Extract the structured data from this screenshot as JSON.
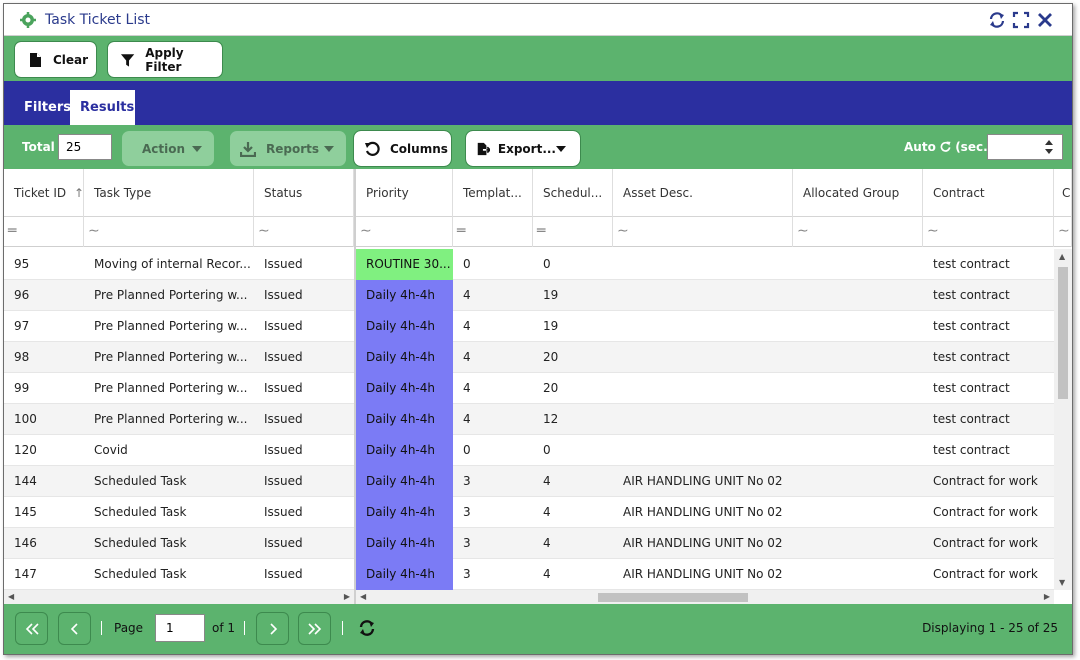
{
  "window": {
    "title": "Task Ticket List"
  },
  "toolbar": {
    "clear_label": "Clear",
    "apply_filter_label": "Apply Filter"
  },
  "tabs": [
    {
      "label": "Filters"
    },
    {
      "label": "Results"
    }
  ],
  "gridbar": {
    "total_label": "Total",
    "total_value": "25",
    "action_label": "Action",
    "reports_label": "Reports",
    "columns_label": "Columns",
    "export_label": "Export...",
    "auto_label": "Auto",
    "auto_unit": "(sec.)"
  },
  "columns": [
    "Ticket ID",
    "Task Type",
    "Status",
    "Priority",
    "Templat...",
    "Schedul...",
    "Asset Desc.",
    "Allocated Group",
    "Contract",
    "C"
  ],
  "rows": [
    [
      "95",
      "Moving of internal Recor...",
      "Issued",
      "ROUTINE 30...",
      "0",
      "0",
      "",
      "",
      "test contract"
    ],
    [
      "96",
      "Pre Planned Portering w...",
      "Issued",
      "Daily 4h-4h",
      "4",
      "19",
      "",
      "",
      "test contract"
    ],
    [
      "97",
      "Pre Planned Portering w...",
      "Issued",
      "Daily 4h-4h",
      "4",
      "19",
      "",
      "",
      "test contract"
    ],
    [
      "98",
      "Pre Planned Portering w...",
      "Issued",
      "Daily 4h-4h",
      "4",
      "20",
      "",
      "",
      "test contract"
    ],
    [
      "99",
      "Pre Planned Portering w...",
      "Issued",
      "Daily 4h-4h",
      "4",
      "20",
      "",
      "",
      "test contract"
    ],
    [
      "100",
      "Pre Planned Portering w...",
      "Issued",
      "Daily 4h-4h",
      "4",
      "12",
      "",
      "",
      "test contract"
    ],
    [
      "120",
      "Covid",
      "Issued",
      "Daily 4h-4h",
      "0",
      "0",
      "",
      "",
      "test contract"
    ],
    [
      "144",
      "Scheduled Task",
      "Issued",
      "Daily 4h-4h",
      "3",
      "4",
      "AIR HANDLING UNIT No 02",
      "",
      "Contract for work"
    ],
    [
      "145",
      "Scheduled Task",
      "Issued",
      "Daily 4h-4h",
      "3",
      "4",
      "AIR HANDLING UNIT No 02",
      "",
      "Contract for work"
    ],
    [
      "146",
      "Scheduled Task",
      "Issued",
      "Daily 4h-4h",
      "3",
      "4",
      "AIR HANDLING UNIT No 02",
      "",
      "Contract for work"
    ],
    [
      "147",
      "Scheduled Task",
      "Issued",
      "Daily 4h-4h",
      "3",
      "4",
      "AIR HANDLING UNIT No 02",
      "",
      "Contract for work"
    ]
  ],
  "priority_colors": {
    "ROUTINE 30...": "#80f080",
    "Daily 4h-4h": "#7b7bf5"
  },
  "pager": {
    "page_label": "Page",
    "page_value": "1",
    "of_label": "of 1",
    "displaying": "Displaying 1 - 25 of 25"
  },
  "colors": {
    "green": "#5cb36e",
    "navy": "#2b2fa0",
    "title": "#2a3a8c"
  }
}
